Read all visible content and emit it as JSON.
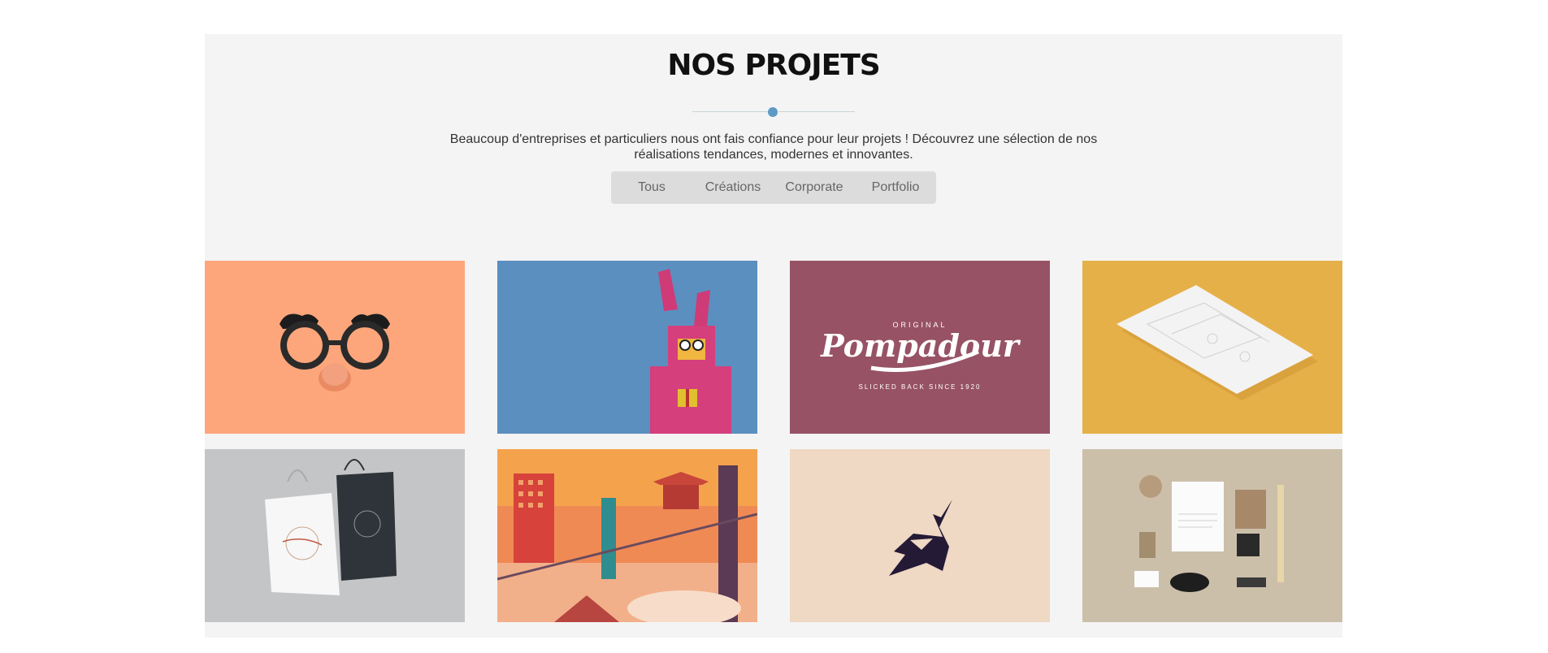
{
  "section": {
    "title": "NOS PROJETS",
    "description_line1": "Beaucoup d'entreprises et particuliers nous ont fais confiance pour leur projets ! Découvrez une sélection de nos",
    "description_line2": "réalisations tendances, modernes et innovantes."
  },
  "filters": [
    "Tous",
    "Créations",
    "Corporate",
    "Portfolio"
  ],
  "projects": [
    {
      "image": "glasses-mustache-illustration",
      "bg": "#fda67b"
    },
    {
      "image": "pink-bunny-illustration",
      "bg": "#5b8fc0"
    },
    {
      "image": "pompadour-logo",
      "bg": "#975265",
      "logo_top": "ORIGINAL",
      "logo_main": "Pompadour",
      "logo_bottom": "SLICKED BACK SINCE 1920"
    },
    {
      "image": "letterhead-mockup",
      "bg": "#e6b049"
    },
    {
      "image": "shopping-bags-mockup",
      "bg": "#c4c5c7"
    },
    {
      "image": "city-sunset-illustration",
      "bg": "#f08a55"
    },
    {
      "image": "geometric-bird-logo",
      "bg": "#efd8c4"
    },
    {
      "image": "stationery-mockup",
      "bg": "#ccbfaa"
    }
  ],
  "colors": {
    "accent": "#5d9ac6",
    "section_bg": "#f4f4f4",
    "filter_bg": "#dcdcdc"
  }
}
